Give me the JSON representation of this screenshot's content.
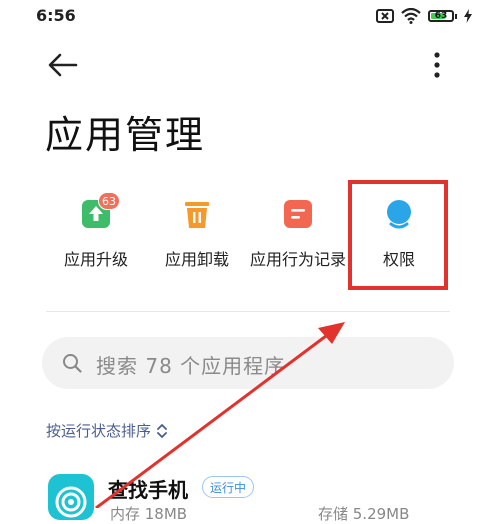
{
  "status_bar": {
    "time": "6:56",
    "battery_level": "63",
    "battery_percent": 63,
    "icons": [
      "sim-off-icon",
      "wifi-icon",
      "battery-icon",
      "charging-icon"
    ]
  },
  "header": {
    "back_icon": "arrow-left-icon",
    "more_icon": "more-vertical-icon",
    "title": "应用管理"
  },
  "quick_actions": [
    {
      "label": "应用升级",
      "icon": "upgrade-icon",
      "color": "#3dbd6a",
      "badge": "63"
    },
    {
      "label": "应用卸载",
      "icon": "trash-icon",
      "color": "#f39a2b"
    },
    {
      "label": "应用行为记录",
      "icon": "record-icon",
      "color": "#f36650"
    },
    {
      "label": "权限",
      "icon": "permission-icon",
      "color": "#2aa6e8"
    }
  ],
  "search": {
    "placeholder": "搜索 78 个应用程序"
  },
  "sort": {
    "label": "按运行状态排序"
  },
  "app_list": [
    {
      "name": "查找手机",
      "status": "运行中",
      "meta_left": "内存 18MB",
      "meta_right": "存储 5.29MB"
    }
  ],
  "colors": {
    "highlight": "#e1322e",
    "annotation_arrow": "#e1322e",
    "sort_text": "#4a5e8c"
  }
}
